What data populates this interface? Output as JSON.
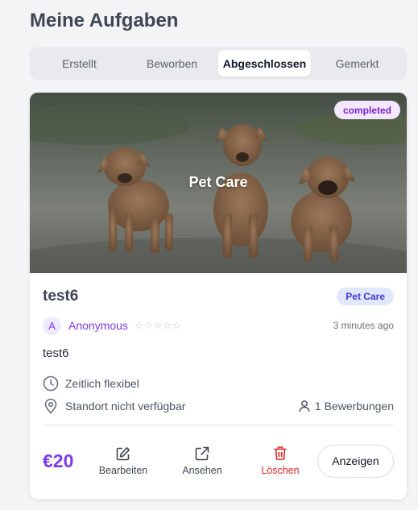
{
  "page": {
    "title": "Meine Aufgaben"
  },
  "tabs": [
    {
      "label": "Erstellt",
      "active": false
    },
    {
      "label": "Beworben",
      "active": false
    },
    {
      "label": "Abgeschlossen",
      "active": true
    },
    {
      "label": "Gemerkt",
      "active": false
    }
  ],
  "task": {
    "image_label": "Pet Care",
    "status": "completed",
    "title": "test6",
    "category": "Pet Care",
    "author": {
      "initial": "A",
      "name": "Anonymous",
      "stars": "☆☆☆☆☆",
      "rating": 0
    },
    "time_ago": "3 minutes ago",
    "description": "test6",
    "schedule": "Zeitlich flexibel",
    "location": "Standort nicht verfügbar",
    "applications": "1 Bewerbungen",
    "price": "€20",
    "actions": {
      "edit": "Bearbeiten",
      "view": "Ansehen",
      "delete": "Löschen",
      "show": "Anzeigen"
    }
  },
  "colors": {
    "accent": "#7c3aed",
    "danger": "#dc2626",
    "status_bg": "#f3e8ff",
    "category_bg": "#e0e7ff"
  },
  "icons": [
    "clock-icon",
    "map-pin-icon",
    "user-icon",
    "edit-icon",
    "external-link-icon",
    "trash-icon"
  ]
}
